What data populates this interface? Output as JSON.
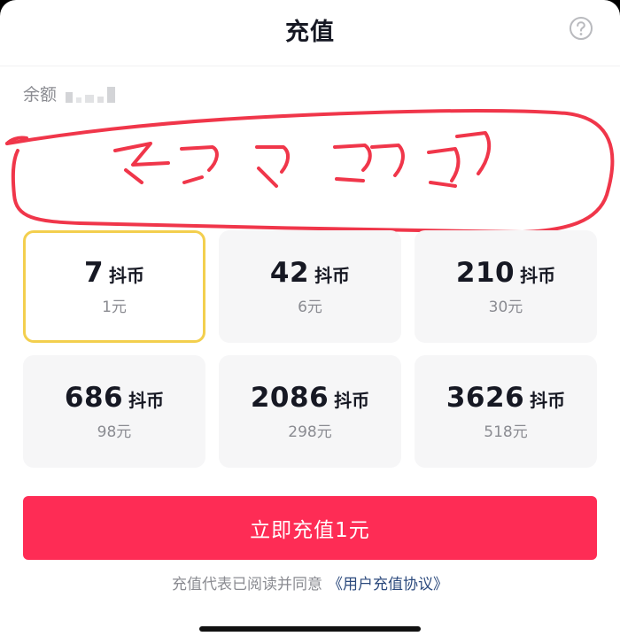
{
  "header": {
    "title": "充值",
    "help_icon": "question-circle-icon"
  },
  "balance": {
    "label": "余额"
  },
  "packages": [
    {
      "coins": "7",
      "unit": "抖币",
      "price": "1元",
      "selected": true
    },
    {
      "coins": "42",
      "unit": "抖币",
      "price": "6元",
      "selected": false
    },
    {
      "coins": "210",
      "unit": "抖币",
      "price": "30元",
      "selected": false
    },
    {
      "coins": "686",
      "unit": "抖币",
      "price": "98元",
      "selected": false
    },
    {
      "coins": "2086",
      "unit": "抖币",
      "price": "298元",
      "selected": false
    },
    {
      "coins": "3626",
      "unit": "抖币",
      "price": "518元",
      "selected": false
    }
  ],
  "pay_button": {
    "label": "立即充值1元"
  },
  "agreement": {
    "text": "充值代表已阅读并同意",
    "link": "《用户充值协议》"
  },
  "colors": {
    "accent": "#fe2c55",
    "selected_border": "#f3cf4e",
    "annotation": "#f0364a",
    "link": "#2c4a7d"
  }
}
